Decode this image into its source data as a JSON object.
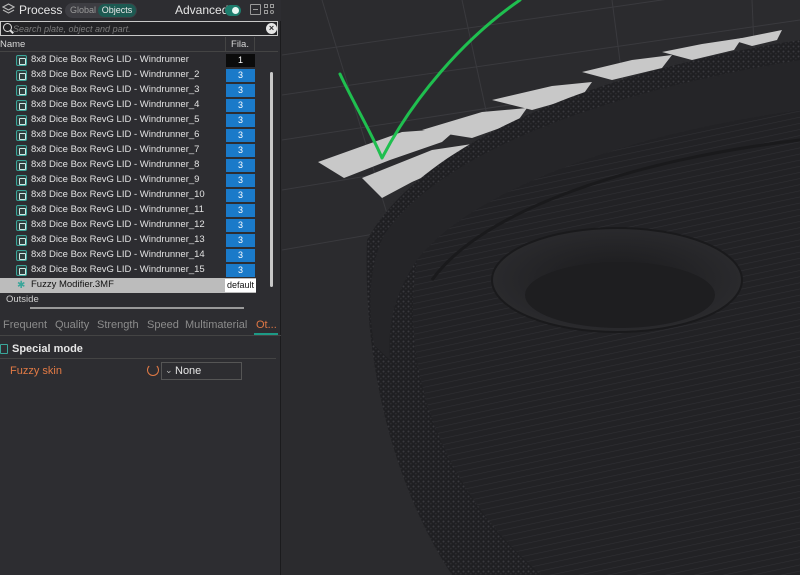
{
  "process": {
    "title": "Process",
    "scope": {
      "global": "Global",
      "objects": "Objects"
    },
    "advanced_label": "Advanced"
  },
  "search": {
    "placeholder": "Search plate, object and part."
  },
  "columns": {
    "name": "Name",
    "filament": "Fila."
  },
  "objects": [
    {
      "name": "8x8 Dice Box RevG LID - Windrunner",
      "filament": "1"
    },
    {
      "name": "8x8 Dice Box RevG LID - Windrunner_2",
      "filament": "3"
    },
    {
      "name": "8x8 Dice Box RevG LID - Windrunner_3",
      "filament": "3"
    },
    {
      "name": "8x8 Dice Box RevG LID - Windrunner_4",
      "filament": "3"
    },
    {
      "name": "8x8 Dice Box RevG LID - Windrunner_5",
      "filament": "3"
    },
    {
      "name": "8x8 Dice Box RevG LID - Windrunner_6",
      "filament": "3"
    },
    {
      "name": "8x8 Dice Box RevG LID - Windrunner_7",
      "filament": "3"
    },
    {
      "name": "8x8 Dice Box RevG LID - Windrunner_8",
      "filament": "3"
    },
    {
      "name": "8x8 Dice Box RevG LID - Windrunner_9",
      "filament": "3"
    },
    {
      "name": "8x8 Dice Box RevG LID - Windrunner_10",
      "filament": "3"
    },
    {
      "name": "8x8 Dice Box RevG LID - Windrunner_11",
      "filament": "3"
    },
    {
      "name": "8x8 Dice Box RevG LID - Windrunner_12",
      "filament": "3"
    },
    {
      "name": "8x8 Dice Box RevG LID - Windrunner_13",
      "filament": "3"
    },
    {
      "name": "8x8 Dice Box RevG LID - Windrunner_14",
      "filament": "3"
    },
    {
      "name": "8x8 Dice Box RevG LID - Windrunner_15",
      "filament": "3"
    }
  ],
  "modifier": {
    "name": "Fuzzy Modifier.3MF",
    "filament": "default"
  },
  "outside_label": "Outside",
  "tabs": [
    {
      "label": "Frequent"
    },
    {
      "label": "Quality"
    },
    {
      "label": "Strength"
    },
    {
      "label": "Speed"
    },
    {
      "label": "Multimaterial"
    },
    {
      "label": "Ot..."
    }
  ],
  "special_mode": {
    "title": "Special mode",
    "fuzzy_skin_label": "Fuzzy skin",
    "fuzzy_skin_value": "None"
  },
  "colors": {
    "accent": "#1d9a86",
    "filament_blue": "#1a7ac9",
    "warning_orange": "#e27a45",
    "annotation_green": "#1fbf4f"
  }
}
